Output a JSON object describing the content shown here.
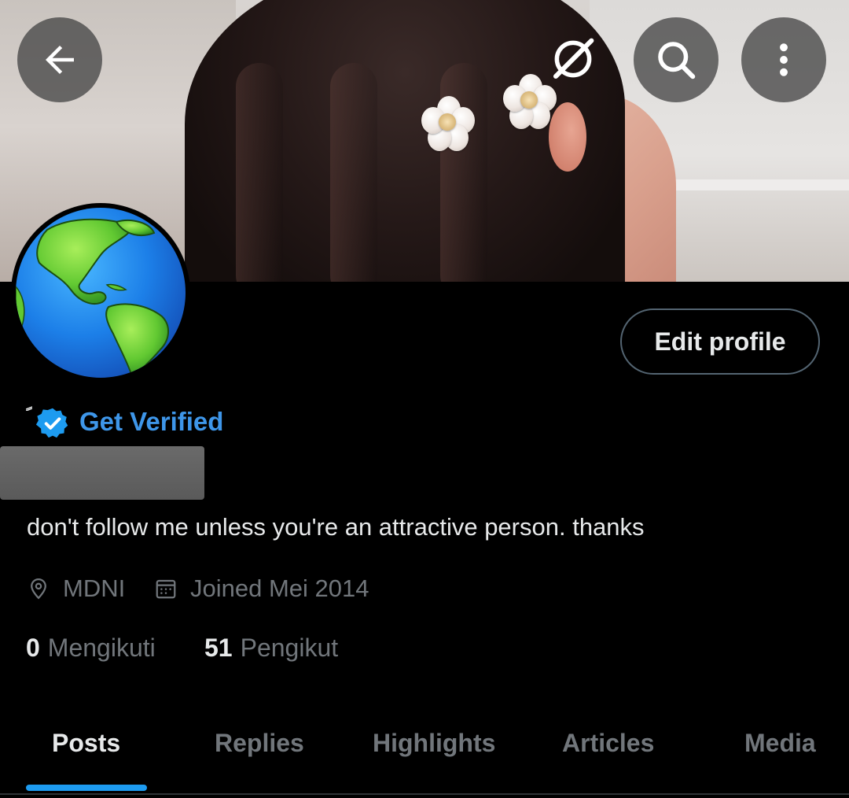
{
  "header": {
    "back_icon": "arrow-left-icon",
    "grok_icon": "grok-icon",
    "search_icon": "search-icon",
    "more_icon": "more-vertical-icon"
  },
  "profile": {
    "avatar_icon": "globe-americas-icon",
    "edit_profile_label": "Edit profile",
    "get_verified_label": "Get Verified",
    "bio": "don't follow me unless you're an attractive person. thanks",
    "location": "MDNI",
    "joined": "Joined Mei 2014",
    "following_count": "0",
    "following_label": "Mengikuti",
    "followers_count": "51",
    "followers_label": "Pengikut"
  },
  "tabs": [
    {
      "label": "Posts"
    },
    {
      "label": "Replies"
    },
    {
      "label": "Highlights"
    },
    {
      "label": "Articles"
    },
    {
      "label": "Media"
    }
  ],
  "colors": {
    "accent": "#1d9bf0",
    "verified_text": "#3e96e9",
    "muted_text": "#71767b",
    "background": "#000000"
  }
}
